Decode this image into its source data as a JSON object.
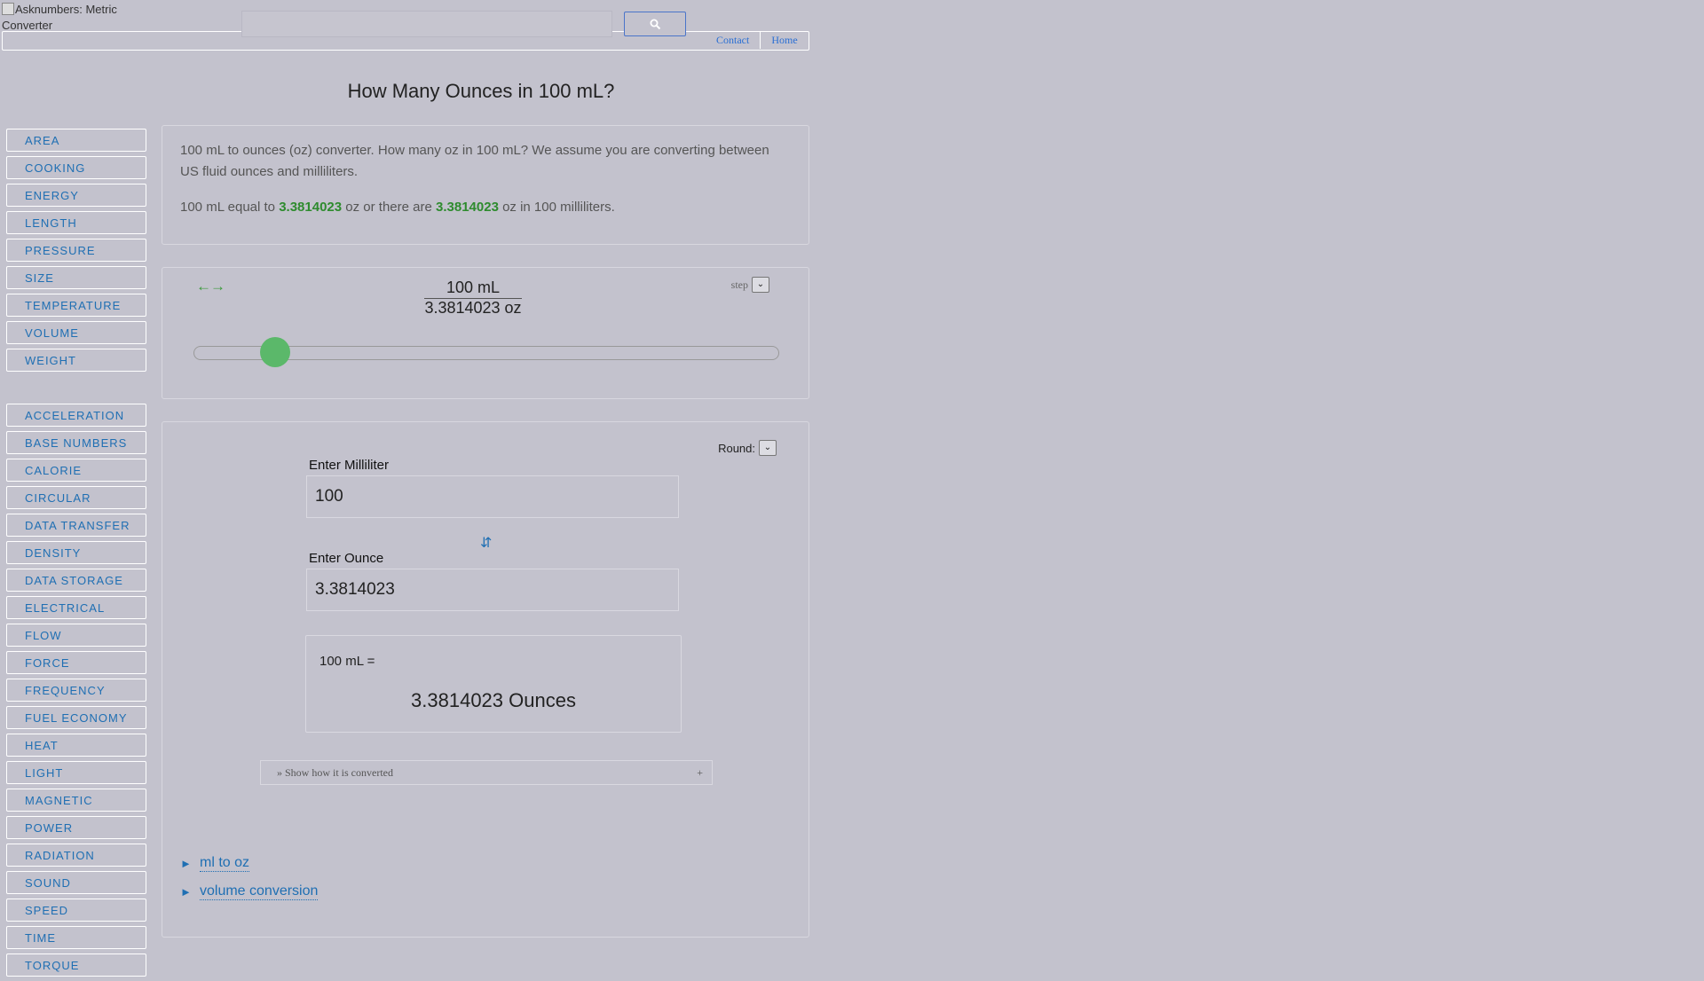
{
  "header": {
    "logo_alt": "Asknumbers: Metric Converter",
    "search_icon": "search-icon",
    "links": [
      "Contact",
      "Home"
    ]
  },
  "page_title": "How Many Ounces in 100 mL?",
  "sidebar": {
    "group1": [
      "AREA",
      "COOKING",
      "ENERGY",
      "LENGTH",
      "PRESSURE",
      "SIZE",
      "TEMPERATURE",
      "VOLUME",
      "WEIGHT"
    ],
    "group2": [
      "ACCELERATION",
      "BASE NUMBERS",
      "CALORIE",
      "CIRCULAR",
      "DATA TRANSFER",
      "DENSITY",
      "DATA STORAGE",
      "ELECTRICAL",
      "FLOW",
      "FORCE",
      "FREQUENCY",
      "FUEL ECONOMY",
      "HEAT",
      "LIGHT",
      "MAGNETIC",
      "POWER",
      "RADIATION",
      "SOUND",
      "SPEED",
      "TIME",
      "TORQUE"
    ]
  },
  "intro": {
    "line1": "100 mL to ounces (oz) converter. How many oz in 100 mL? We assume you are converting between US fluid ounces and milliliters.",
    "line2_a": "100 mL equal to ",
    "value1": "3.3814023",
    "line2_b": " oz or there are ",
    "value2": "3.3814023",
    "line2_c": " oz in 100 milliliters."
  },
  "slider_panel": {
    "arrows": "←→",
    "numerator": "100 mL",
    "denominator": "3.3814023 oz",
    "step_label": "step",
    "slider_fraction": 0.12
  },
  "converter": {
    "round_label": "Round:",
    "input1_label": "Enter Milliliter",
    "input1_value": "100",
    "swap_icon": "⇵",
    "input2_label": "Enter Ounce",
    "input2_value": "3.3814023",
    "result_line1": "100 mL =",
    "result_line2": "3.3814023 Ounces",
    "show_how": "» Show how it is converted",
    "show_how_plus": "+"
  },
  "related_links": [
    "ml to oz",
    "volume conversion"
  ],
  "colors": {
    "accent_green": "#2e8b2e",
    "link_blue": "#1f6fb3",
    "thumb_green": "#5bb86a"
  }
}
